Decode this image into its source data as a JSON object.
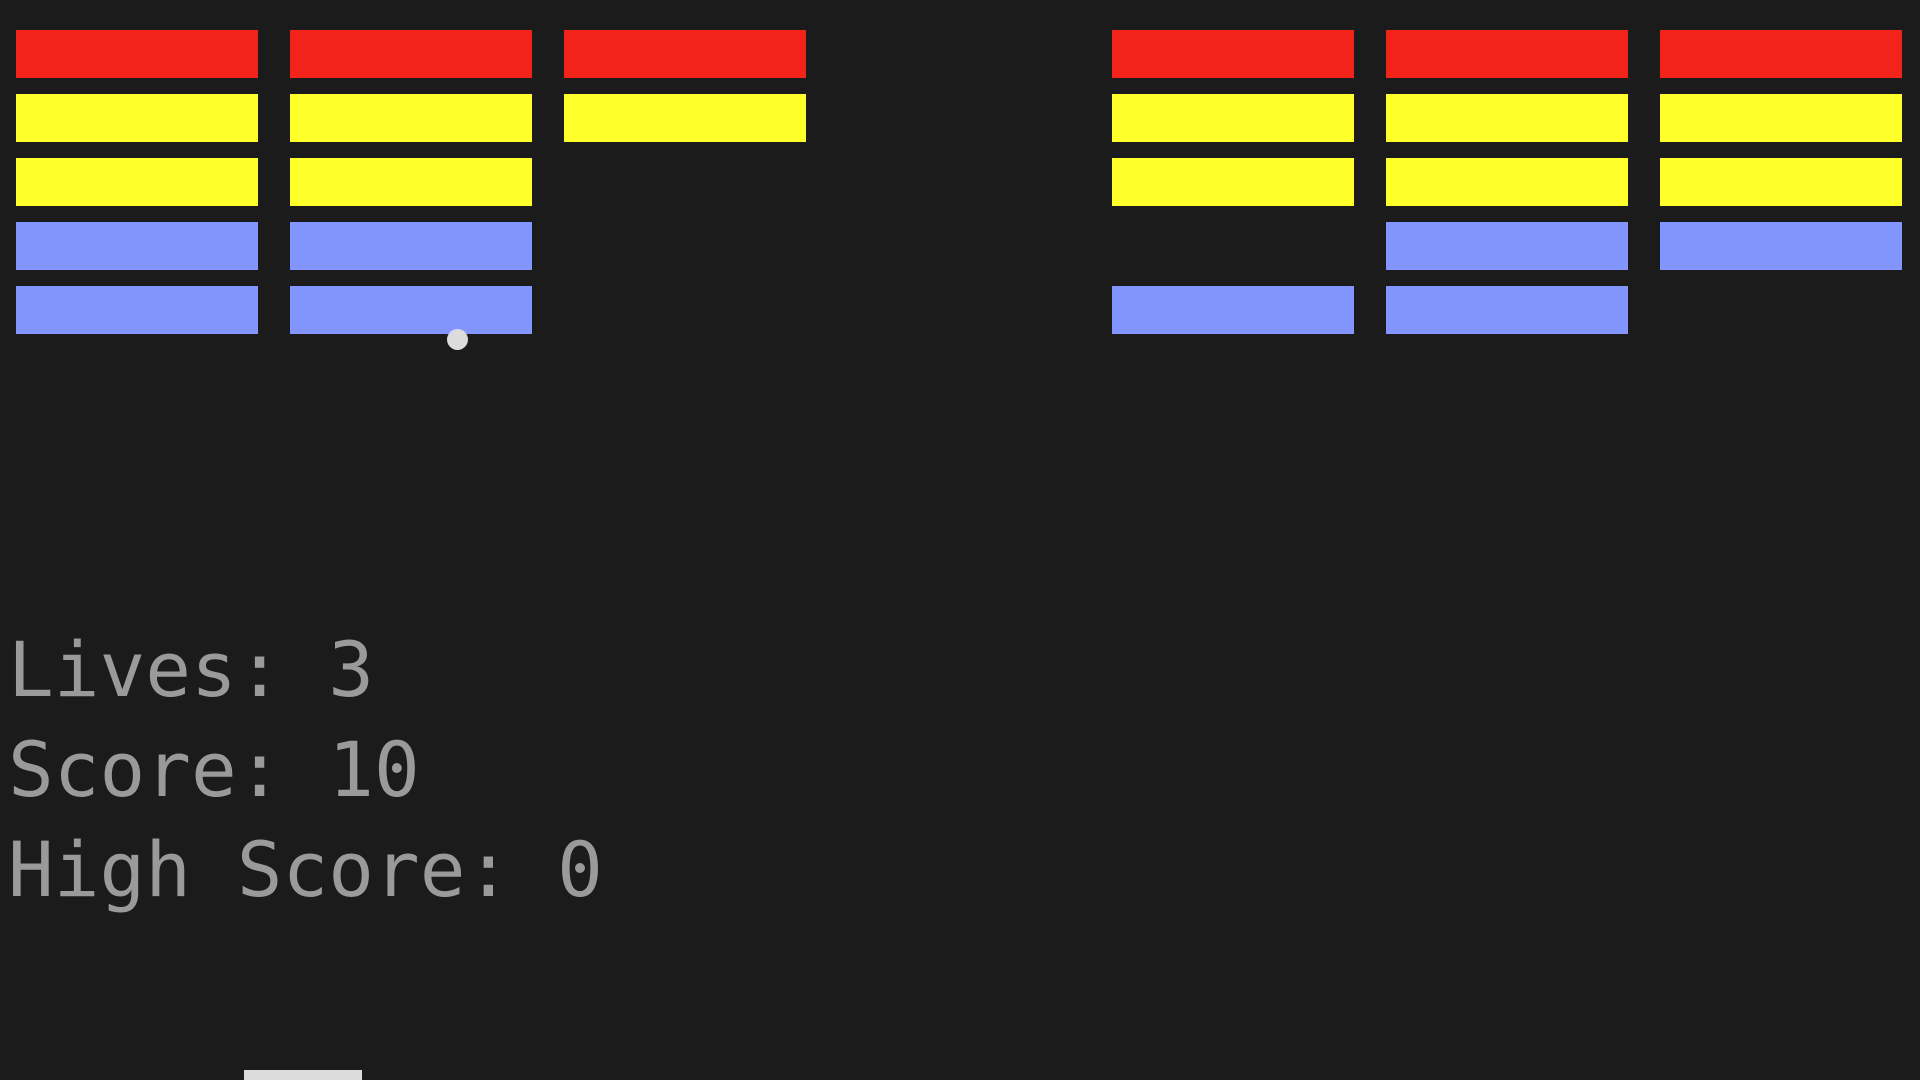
{
  "hud": {
    "lives_text": "Lives: 3",
    "score_text": "Score: 10",
    "high_score_text": "High Score: 0",
    "lives": 3,
    "score": 10,
    "high_score": 0
  },
  "colors": {
    "background": "#1b1b1b",
    "hud_text": "#9a9a9a",
    "ball": "#dcdcdc",
    "paddle": "#dcdcdc",
    "row_colors": [
      "#f2231a",
      "#ffff2a",
      "#ffff2a",
      "#8295ff",
      "#8295ff"
    ]
  },
  "bricks": {
    "columns": 7,
    "rows": 5,
    "present": [
      [
        true,
        true,
        true,
        false,
        true,
        true,
        true
      ],
      [
        true,
        true,
        true,
        false,
        true,
        true,
        true
      ],
      [
        true,
        true,
        false,
        false,
        true,
        true,
        true
      ],
      [
        true,
        true,
        false,
        false,
        false,
        true,
        true
      ],
      [
        true,
        true,
        false,
        false,
        true,
        true,
        false
      ]
    ]
  }
}
